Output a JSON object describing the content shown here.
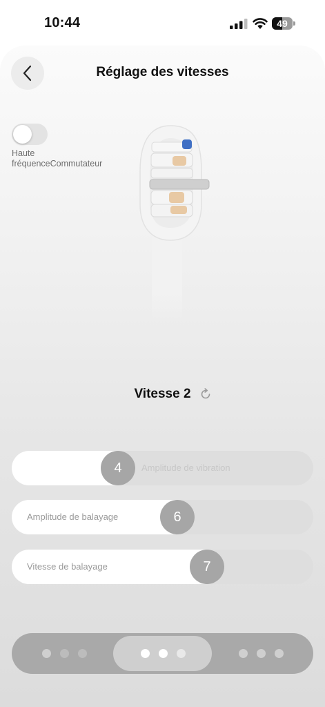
{
  "status_bar": {
    "time": "10:44",
    "battery": "49",
    "battery_level": 0.49
  },
  "header": {
    "title": "Réglage des vitesses",
    "back_icon": "chevron-left-icon"
  },
  "toggle": {
    "label": "Haute fréquenceCommutateur",
    "on": false
  },
  "speed": {
    "label": "Vitesse 2",
    "refresh_icon": "refresh-icon"
  },
  "sliders": [
    {
      "label": "Amplitude de vibration",
      "value": "4"
    },
    {
      "label": "Amplitude de balayage",
      "value": "6"
    },
    {
      "label": "Vitesse de balayage",
      "value": "7"
    }
  ],
  "pager": {
    "segments": 3,
    "active_segment": 2,
    "dots_per_segment": 3
  }
}
